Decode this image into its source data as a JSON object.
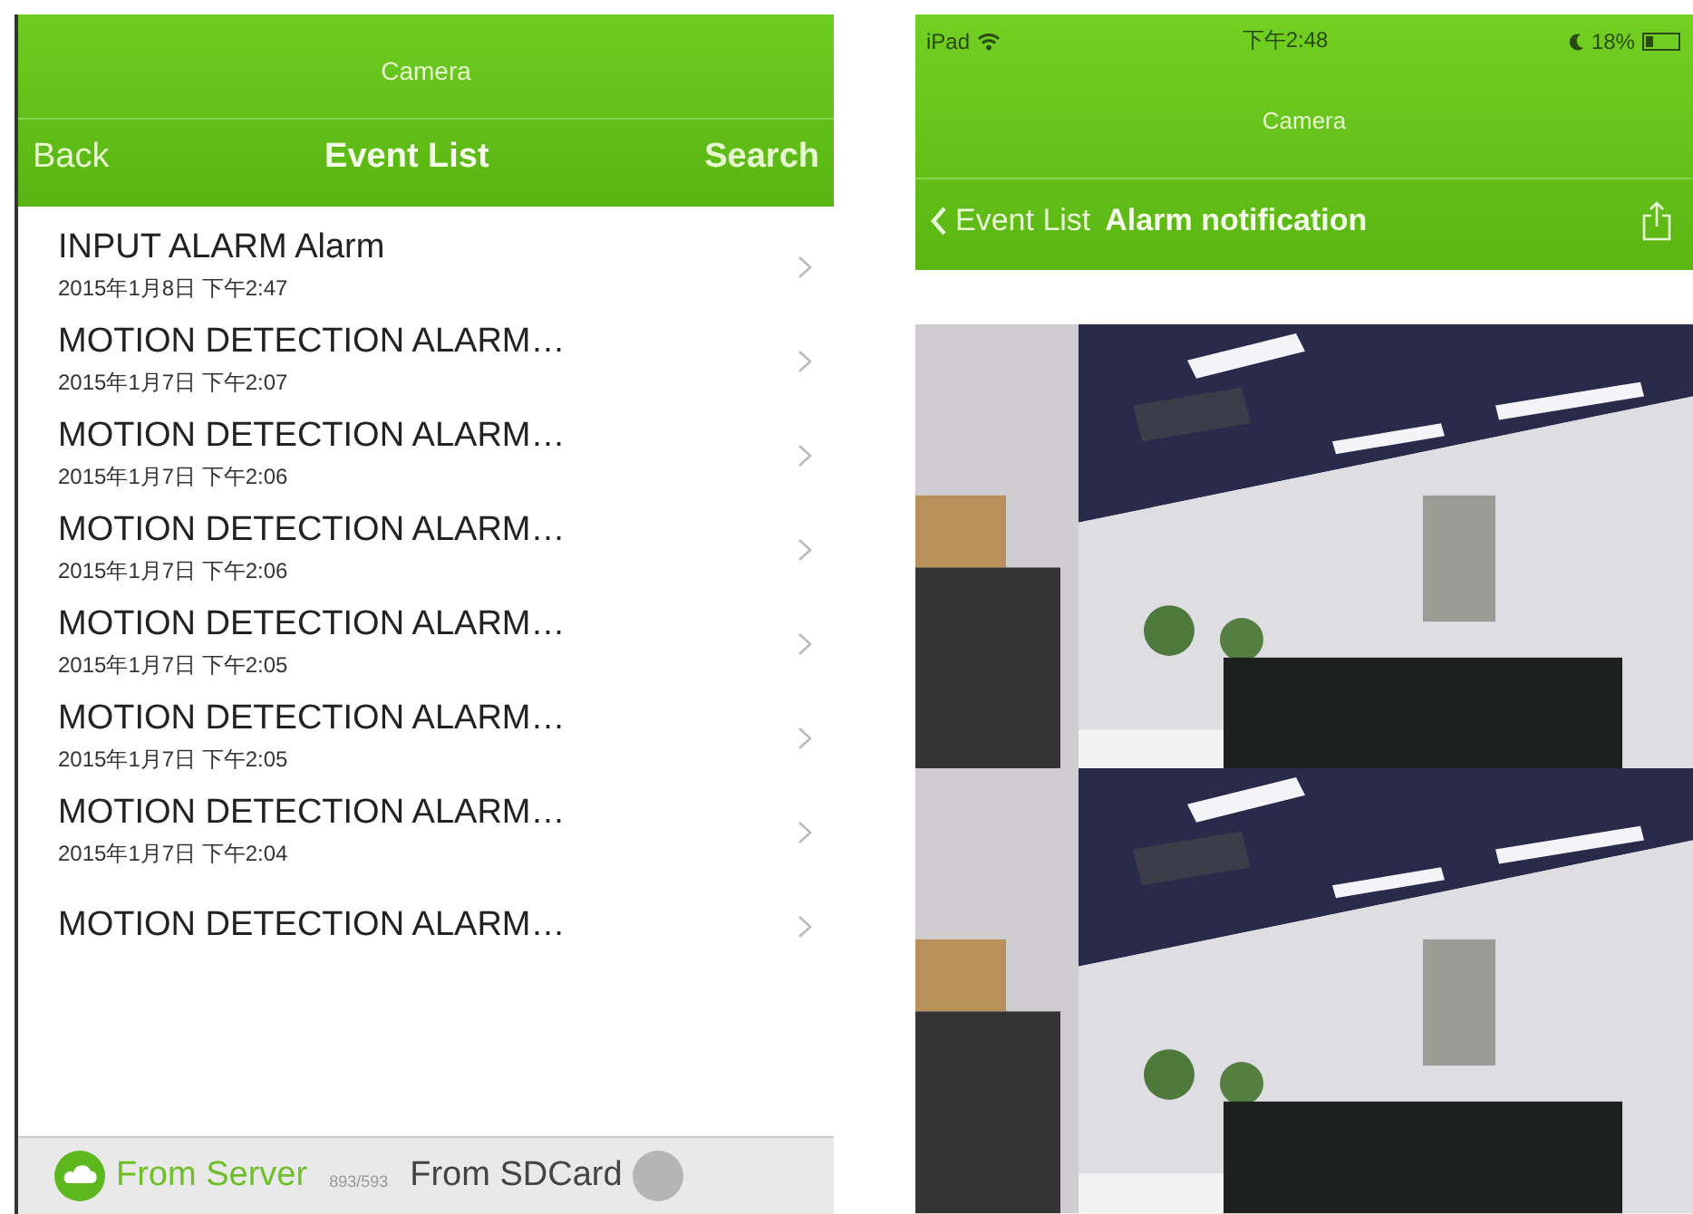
{
  "left_screen": {
    "app_title": "Camera",
    "nav": {
      "back": "Back",
      "title": "Event List",
      "action": "Search"
    },
    "events": [
      {
        "title": "INPUT ALARM Alarm",
        "time": "2015年1月8日 下午2:47"
      },
      {
        "title": "MOTION DETECTION ALARM…",
        "time": "2015年1月7日 下午2:07"
      },
      {
        "title": "MOTION DETECTION ALARM…",
        "time": "2015年1月7日 下午2:06"
      },
      {
        "title": "MOTION DETECTION ALARM…",
        "time": "2015年1月7日 下午2:06"
      },
      {
        "title": "MOTION DETECTION ALARM…",
        "time": "2015年1月7日 下午2:05"
      },
      {
        "title": "MOTION DETECTION ALARM…",
        "time": "2015年1月7日 下午2:05"
      },
      {
        "title": "MOTION DETECTION ALARM…",
        "time": "2015年1月7日 下午2:04"
      },
      {
        "title": "MOTION DETECTION ALARM…"
      }
    ],
    "tabs": [
      {
        "label": "From Server",
        "selected": true
      },
      {
        "label": "From SDCard",
        "selected": false
      }
    ],
    "count": "893/593"
  },
  "right_screen": {
    "status_bar": {
      "device": "iPad",
      "time": "下午2:48",
      "battery": "18%"
    },
    "app_title": "Camera",
    "nav": {
      "back": "Event List",
      "title": "Alarm notification"
    }
  }
}
